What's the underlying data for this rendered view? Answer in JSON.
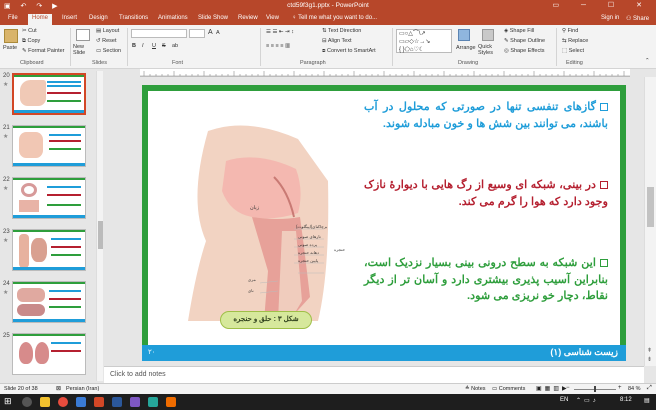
{
  "window": {
    "title": "ctd59f3g1.pptx - PowerPoint",
    "qat_icons": "save-icon undo-icon redo-icon present-icon"
  },
  "menu": {
    "tabs": [
      "File",
      "Home",
      "Insert",
      "Design",
      "Transitions",
      "Animations",
      "Slide Show",
      "Review",
      "View"
    ],
    "active": "Home",
    "tell_me": "Tell me what you want to do...",
    "sign_in": "Sign in",
    "share": "Share"
  },
  "ribbon": {
    "clipboard": {
      "paste": "Paste",
      "cut": "Cut",
      "copy": "Copy",
      "format_painter": "Format Painter",
      "group": "Clipboard"
    },
    "slides": {
      "new_slide": "New Slide",
      "layout": "Layout",
      "reset": "Reset",
      "section": "Section",
      "group": "Slides"
    },
    "font": {
      "group": "Font",
      "bold": "B",
      "italic": "I",
      "underline": "U",
      "strike": "S",
      "shadow": "ab",
      "size_up": "A",
      "size_down": "A"
    },
    "paragraph": {
      "group": "Paragraph",
      "text_direction": "Text Direction",
      "align_text": "Align Text",
      "smartart": "Convert to SmartArt"
    },
    "drawing": {
      "group": "Drawing",
      "arrange": "Arrange",
      "quick_styles": "Quick Styles",
      "shape_fill": "Shape Fill",
      "shape_outline": "Shape Outline",
      "shape_effects": "Shape Effects"
    },
    "editing": {
      "group": "Editing",
      "find": "Find",
      "replace": "Replace",
      "select": "Select"
    }
  },
  "thumbnails": [
    {
      "num": "20",
      "star": "★"
    },
    {
      "num": "21",
      "star": "★"
    },
    {
      "num": "22",
      "star": "★"
    },
    {
      "num": "23",
      "star": "★"
    },
    {
      "num": "24",
      "star": "★"
    },
    {
      "num": "25",
      "star": ""
    }
  ],
  "slide": {
    "bullet1": "گازهای تنفسی تنها در صورتی که محلول در آب باشند، می توانند بین شش ها و خون مبادله شوند.",
    "bullet2": "در بینی، شبکه ای وسیع از رگ هایی با دیوارهٔ نازک وجود دارد که هوا را گرم می کند.",
    "bullet3": "این شبکه به سطح درونی بینی بسیار نزدیک است، بنابراین آسیب پذیری بیشتری دارد و آسان تر از دیگر نقاط، دچار خو نریزی می شود.",
    "caption": "شکل ۳ : حلق و حنجره",
    "footer": "زیست شناسی (۱)",
    "page_no": "۲۰",
    "fig_labels": {
      "tongue": "زبان",
      "epiglottis": "برچاکنای(اپیگلوت)",
      "vocal1": "تارهای صوتی",
      "vocal2": "پرده صوتی",
      "larynx_entry": "دهانه حنجره",
      "lower": "پایین حنجره",
      "larynx": "حنجره",
      "esophagus": "مری",
      "trachea": "نای"
    }
  },
  "notes": "Click to add notes",
  "status": {
    "slide_info": "Slide 20 of 38",
    "language": "Persian (Iran)",
    "notes_btn": "Notes",
    "comments_btn": "Comments",
    "zoom": "84 %"
  },
  "taskbar": {
    "lang": "EN",
    "time": "8:12"
  },
  "colors": {
    "accent": "#b7472a",
    "slide_border": "#2e9e3c",
    "footer_blue": "#1f9dd9",
    "blue_text": "#1f9dd9",
    "red_text": "#b52030",
    "green_text": "#2e9e3c",
    "caption_bg": "#d6e89c"
  }
}
